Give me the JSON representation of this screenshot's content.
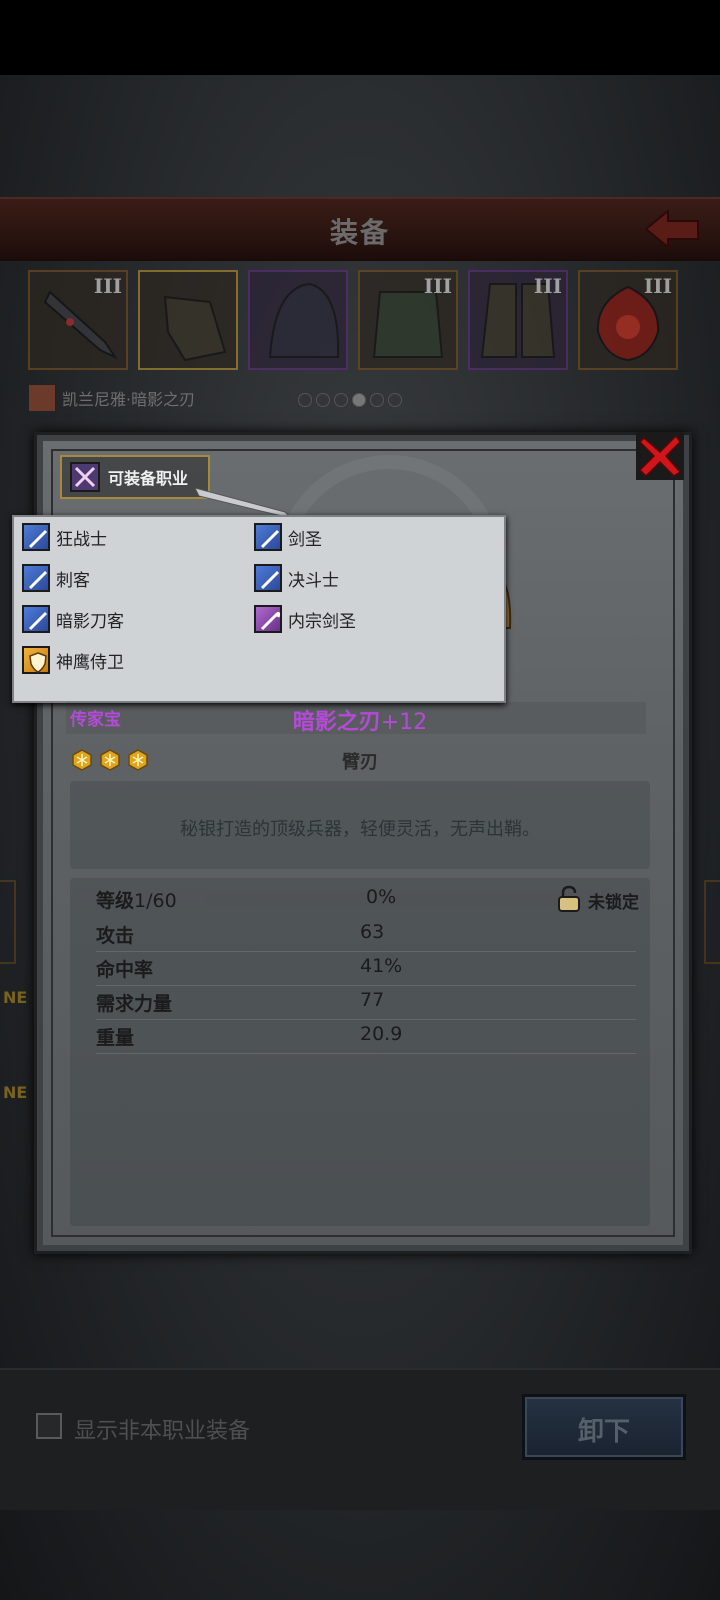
{
  "header": {
    "title": "装备"
  },
  "equipment_slots": [
    {
      "tier": "III",
      "icon": "curved-blade-icon",
      "rarity": "orange"
    },
    {
      "tier": "",
      "icon": "gauntlet-icon",
      "rarity": "orange"
    },
    {
      "tier": "",
      "icon": "hood-icon",
      "rarity": "purple"
    },
    {
      "tier": "III",
      "icon": "armor-icon",
      "rarity": "orange"
    },
    {
      "tier": "III",
      "icon": "boots-icon",
      "rarity": "purple"
    },
    {
      "tier": "III",
      "icon": "phoenix-emblem-icon",
      "rarity": "orange"
    }
  ],
  "character": {
    "name": "凯兰尼雅·暗影之刃"
  },
  "page_dots": {
    "count": 6,
    "active": 3
  },
  "job_button": {
    "label": "可装备职业"
  },
  "jobs": [
    {
      "name": "狂战士",
      "icon_color": "blue"
    },
    {
      "name": "剑圣",
      "icon_color": "blue"
    },
    {
      "name": "刺客",
      "icon_color": "blue"
    },
    {
      "name": "决斗士",
      "icon_color": "blue"
    },
    {
      "name": "暗影刀客",
      "icon_color": "blue"
    },
    {
      "name": "内宗剑圣",
      "icon_color": "purple"
    },
    {
      "name": "神鹰侍卫",
      "icon_color": "orange"
    }
  ],
  "item": {
    "grade": "传家宝",
    "name": "暗影之刃",
    "enhance": "+12",
    "stars": 3,
    "type": "臂刃",
    "description": "秘银打造的顶级兵器，轻便灵活，无声出鞘。",
    "level_label": "等级",
    "level": "1/60",
    "xp_percent": "0%",
    "xp_fraction": 0.0,
    "lock_status": "未锁定",
    "stats": [
      {
        "label": "攻击",
        "value": "63"
      },
      {
        "label": "命中率",
        "value": "41%"
      },
      {
        "label": "需求力量",
        "value": "77"
      },
      {
        "label": "重量",
        "value": "20.9"
      }
    ]
  },
  "side_labels": {
    "left1": "NE",
    "left2": "NE"
  },
  "bottom": {
    "checkbox_label": "显示非本职业装备",
    "unequip_label": "卸下"
  },
  "colors": {
    "grade_purple": "#b44ad8",
    "gold_border": "#a58a3c",
    "close_red": "#d0161a"
  }
}
